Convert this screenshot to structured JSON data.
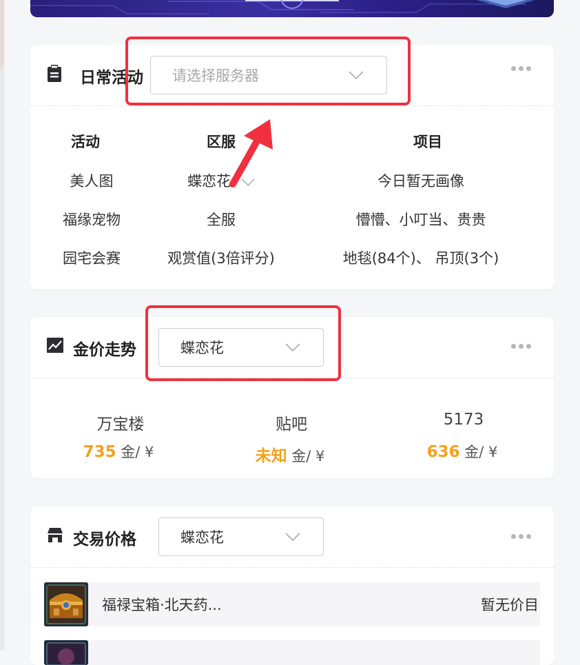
{
  "daily": {
    "title": "日常活动",
    "select_placeholder": "请选择服务器",
    "columns": [
      "活动",
      "区服",
      "项目"
    ],
    "rows": [
      {
        "activity": "美人图",
        "server": "蝶恋花",
        "item": "今日暂无画像"
      },
      {
        "activity": "福缘宠物",
        "server": "全服",
        "item": "懵懵、小叮当、贵贵"
      },
      {
        "activity": "园宅会赛",
        "server": "观赏值(3倍评分)",
        "item": "地毯(84个)、 吊顶(3个)"
      }
    ]
  },
  "gold": {
    "title": "金价走势",
    "selected_server": "蝶恋花",
    "unit": "金/ ¥",
    "sources": [
      {
        "name": "万宝楼",
        "price": "735"
      },
      {
        "name": "贴吧",
        "price": "未知"
      },
      {
        "name": "5173",
        "price": "636"
      }
    ]
  },
  "trade": {
    "title": "交易价格",
    "selected_server": "蝶恋花",
    "items": [
      {
        "name": "福禄宝箱·北天药...",
        "price": "暂无价目"
      }
    ]
  },
  "colors": {
    "accent_gold": "#f5a01d",
    "annotation_red": "#f0303f",
    "banner": "#2a1f7a"
  },
  "icons": {
    "daily": "clipboard-icon",
    "gold": "trend-chart-icon",
    "trade": "shop-icon",
    "more": "more-dots-icon",
    "chevron": "chevron-down-icon"
  }
}
